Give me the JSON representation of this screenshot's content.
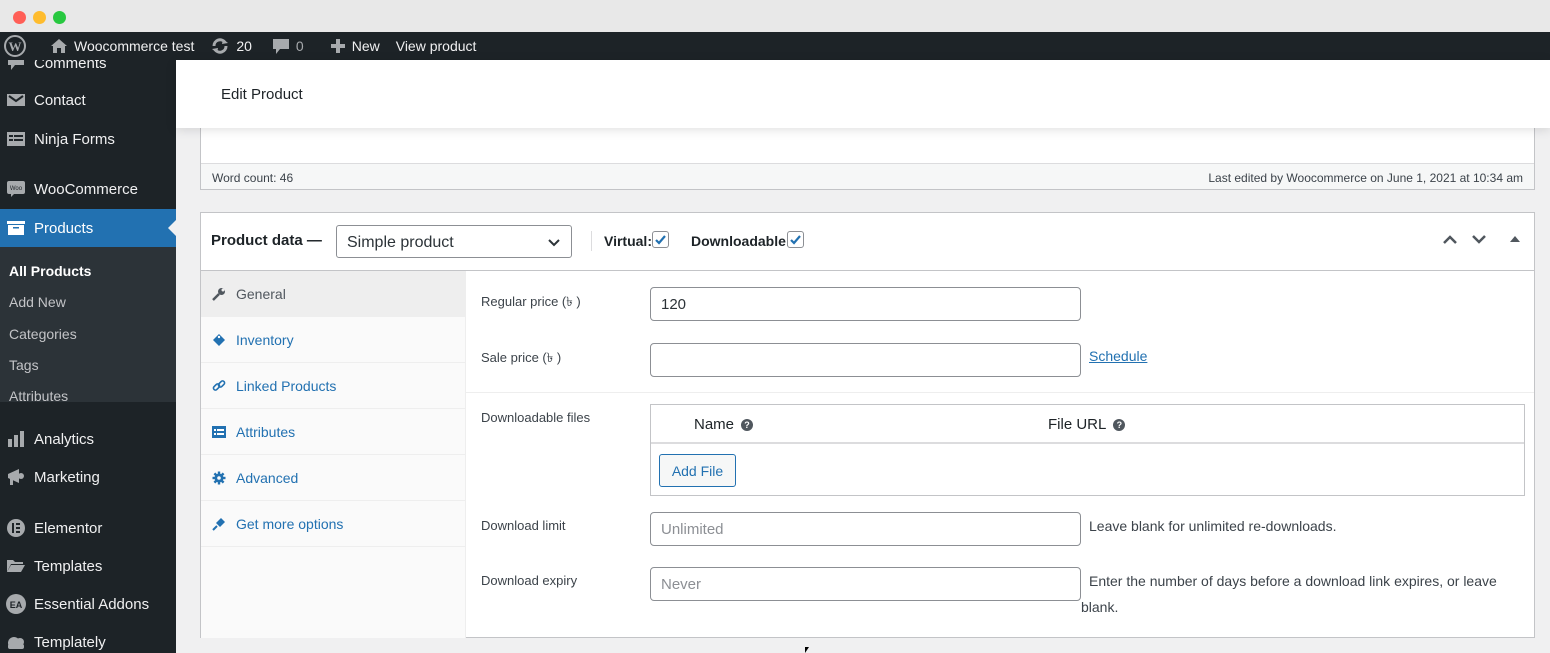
{
  "window": {
    "controls": [
      "close",
      "minimize",
      "maximize"
    ]
  },
  "adminbar": {
    "site_name": "Woocommerce test",
    "updates_count": "20",
    "comments_count": "0",
    "new_label": "New",
    "view_label": "View product"
  },
  "sidebar": {
    "items": [
      {
        "label": "Comments",
        "icon": "comment-icon"
      },
      {
        "label": "Contact",
        "icon": "envelope-icon"
      },
      {
        "label": "Ninja Forms",
        "icon": "forms-icon"
      },
      {
        "label": "WooCommerce",
        "icon": "woo-icon"
      },
      {
        "label": "Products",
        "icon": "archive-icon",
        "active": true
      },
      {
        "label": "Analytics",
        "icon": "bar-chart-icon"
      },
      {
        "label": "Marketing",
        "icon": "megaphone-icon"
      },
      {
        "label": "Elementor",
        "icon": "elementor-icon"
      },
      {
        "label": "Templates",
        "icon": "folder-icon"
      },
      {
        "label": "Essential Addons",
        "icon": "ea-icon"
      },
      {
        "label": "Templately",
        "icon": "cloud-icon"
      }
    ],
    "submenu": [
      {
        "label": "All Products",
        "current": true
      },
      {
        "label": "Add New"
      },
      {
        "label": "Categories"
      },
      {
        "label": "Tags"
      },
      {
        "label": "Attributes"
      }
    ]
  },
  "header": {
    "title": "Edit Product"
  },
  "editor_status": {
    "word_count": "Word count: 46",
    "last_edited": "Last edited by Woocommerce on June 1, 2021 at 10:34 am"
  },
  "product_data": {
    "title": "Product data —",
    "type_selected": "Simple product",
    "virtual_label": "Virtual:",
    "virtual_checked": true,
    "downloadable_label": "Downloadable:",
    "downloadable_checked": true,
    "tabs": [
      {
        "label": "General",
        "icon": "wrench-icon",
        "active": true
      },
      {
        "label": "Inventory",
        "icon": "tag-icon"
      },
      {
        "label": "Linked Products",
        "icon": "link-icon"
      },
      {
        "label": "Attributes",
        "icon": "list-icon"
      },
      {
        "label": "Advanced",
        "icon": "gear-icon"
      },
      {
        "label": "Get more options",
        "icon": "plugin-icon"
      }
    ],
    "general": {
      "regular_price_label": "Regular price (৳ )",
      "regular_price_value": "120",
      "sale_price_label": "Sale price (৳ )",
      "sale_price_value": "",
      "schedule_link": "Schedule",
      "downloadable_files_label": "Downloadable files",
      "files_columns": [
        "Name",
        "File URL"
      ],
      "help_glyph": "?",
      "add_file_label": "Add File",
      "download_limit_label": "Download limit",
      "download_limit_placeholder": "Unlimited",
      "download_limit_desc": "Leave blank for unlimited re-downloads.",
      "download_expiry_label": "Download expiry",
      "download_expiry_placeholder": "Never",
      "download_expiry_desc": "Enter the number of days before a download link expires, or leave blank."
    }
  }
}
